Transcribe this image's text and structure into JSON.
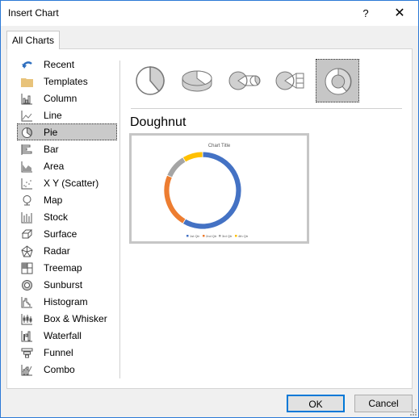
{
  "window": {
    "title": "Insert Chart",
    "help_label": "?",
    "close_label": "✕"
  },
  "tabs": [
    {
      "label": "All Charts",
      "selected": true
    }
  ],
  "sidebar": {
    "items": [
      {
        "label": "Recent",
        "icon": "recent-icon"
      },
      {
        "label": "Templates",
        "icon": "folder-icon"
      },
      {
        "label": "Column",
        "icon": "column-chart-icon"
      },
      {
        "label": "Line",
        "icon": "line-chart-icon"
      },
      {
        "label": "Pie",
        "icon": "pie-chart-icon",
        "selected": true
      },
      {
        "label": "Bar",
        "icon": "bar-chart-icon"
      },
      {
        "label": "Area",
        "icon": "area-chart-icon"
      },
      {
        "label": "X Y (Scatter)",
        "icon": "scatter-chart-icon"
      },
      {
        "label": "Map",
        "icon": "map-chart-icon"
      },
      {
        "label": "Stock",
        "icon": "stock-chart-icon"
      },
      {
        "label": "Surface",
        "icon": "surface-chart-icon"
      },
      {
        "label": "Radar",
        "icon": "radar-chart-icon"
      },
      {
        "label": "Treemap",
        "icon": "treemap-chart-icon"
      },
      {
        "label": "Sunburst",
        "icon": "sunburst-chart-icon"
      },
      {
        "label": "Histogram",
        "icon": "histogram-chart-icon"
      },
      {
        "label": "Box & Whisker",
        "icon": "box-whisker-chart-icon"
      },
      {
        "label": "Waterfall",
        "icon": "waterfall-chart-icon"
      },
      {
        "label": "Funnel",
        "icon": "funnel-chart-icon"
      },
      {
        "label": "Combo",
        "icon": "combo-chart-icon"
      }
    ]
  },
  "subtypes": [
    {
      "name": "Pie",
      "icon": "pie-icon"
    },
    {
      "name": "3-D Pie",
      "icon": "pie-3d-icon"
    },
    {
      "name": "Pie of Pie",
      "icon": "pie-of-pie-icon"
    },
    {
      "name": "Bar of Pie",
      "icon": "bar-of-pie-icon"
    },
    {
      "name": "Doughnut",
      "icon": "doughnut-icon",
      "selected": true
    }
  ],
  "preview": {
    "heading": "Doughnut"
  },
  "chart_data": {
    "type": "pie",
    "variant": "doughnut",
    "title": "Chart Title",
    "categories": [
      "1st Qtr",
      "2nd Qtr",
      "3rd Qtr",
      "4th Qtr"
    ],
    "values": [
      8.2,
      3.2,
      1.4,
      1.2
    ],
    "colors": [
      "#4472c4",
      "#ed7d31",
      "#a5a5a5",
      "#ffc000"
    ],
    "legend": "bottom"
  },
  "footer": {
    "ok_label": "OK",
    "cancel_label": "Cancel"
  },
  "colors": {
    "accent": "#0078d7",
    "window_border": "#2b79d6",
    "selection": "#cacaca"
  }
}
